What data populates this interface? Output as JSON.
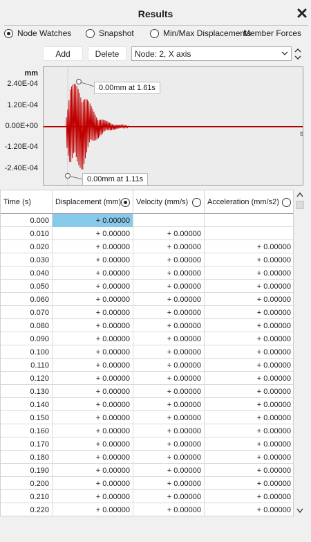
{
  "window": {
    "title": "Results"
  },
  "modes": [
    {
      "label": "Node Watches",
      "selected": true
    },
    {
      "label": "Snapshot",
      "selected": false
    },
    {
      "label": "Min/Max Displacements",
      "selected": false
    },
    {
      "label": "Member Forces",
      "selected": false
    }
  ],
  "toolbar": {
    "add_label": "Add",
    "delete_label": "Delete",
    "node_select": "Node: 2, X axis"
  },
  "chart": {
    "unit_label": "mm",
    "y_ticks": [
      "2.40E-04",
      "1.20E-04",
      "0.00E+00",
      "-1.20E-04",
      "-2.40E-04"
    ],
    "x_unit": "s",
    "max_callout": "0.00mm at 1.61s",
    "min_callout": "0.00mm at 1.11s"
  },
  "chart_data": {
    "type": "line",
    "series": [
      {
        "color": "#c00000"
      }
    ],
    "y_ticks": [
      0.00024,
      0.00012,
      0.0,
      -0.00012,
      -0.00024
    ],
    "ylim": [
      -0.0003,
      0.0003
    ],
    "peak_max": {
      "value_mm": 0.0,
      "time_s": 1.61
    },
    "peak_min": {
      "value_mm": 0.0,
      "time_s": 1.11
    },
    "ylabel": "mm",
    "xlabel": "s",
    "grid": false
  },
  "table": {
    "columns": [
      "Time (s)",
      "Displacement (mm)",
      "Velocity (mm/s)",
      "Acceleration (mm/s2)"
    ],
    "selected_column": 1,
    "rows": [
      [
        "0.000",
        "+ 0.00000",
        "",
        ""
      ],
      [
        "0.010",
        "+ 0.00000",
        "+ 0.00000",
        ""
      ],
      [
        "0.020",
        "+ 0.00000",
        "+ 0.00000",
        "+ 0.00000"
      ],
      [
        "0.030",
        "+ 0.00000",
        "+ 0.00000",
        "+ 0.00000"
      ],
      [
        "0.040",
        "+ 0.00000",
        "+ 0.00000",
        "+ 0.00000"
      ],
      [
        "0.050",
        "+ 0.00000",
        "+ 0.00000",
        "+ 0.00000"
      ],
      [
        "0.060",
        "+ 0.00000",
        "+ 0.00000",
        "+ 0.00000"
      ],
      [
        "0.070",
        "+ 0.00000",
        "+ 0.00000",
        "+ 0.00000"
      ],
      [
        "0.080",
        "+ 0.00000",
        "+ 0.00000",
        "+ 0.00000"
      ],
      [
        "0.090",
        "+ 0.00000",
        "+ 0.00000",
        "+ 0.00000"
      ],
      [
        "0.100",
        "+ 0.00000",
        "+ 0.00000",
        "+ 0.00000"
      ],
      [
        "0.110",
        "+ 0.00000",
        "+ 0.00000",
        "+ 0.00000"
      ],
      [
        "0.120",
        "+ 0.00000",
        "+ 0.00000",
        "+ 0.00000"
      ],
      [
        "0.130",
        "+ 0.00000",
        "+ 0.00000",
        "+ 0.00000"
      ],
      [
        "0.140",
        "+ 0.00000",
        "+ 0.00000",
        "+ 0.00000"
      ],
      [
        "0.150",
        "+ 0.00000",
        "+ 0.00000",
        "+ 0.00000"
      ],
      [
        "0.160",
        "+ 0.00000",
        "+ 0.00000",
        "+ 0.00000"
      ],
      [
        "0.170",
        "+ 0.00000",
        "+ 0.00000",
        "+ 0.00000"
      ],
      [
        "0.180",
        "+ 0.00000",
        "+ 0.00000",
        "+ 0.00000"
      ],
      [
        "0.190",
        "+ 0.00000",
        "+ 0.00000",
        "+ 0.00000"
      ],
      [
        "0.200",
        "+ 0.00000",
        "+ 0.00000",
        "+ 0.00000"
      ],
      [
        "0.210",
        "+ 0.00000",
        "+ 0.00000",
        "+ 0.00000"
      ],
      [
        "0.220",
        "+ 0.00000",
        "+ 0.00000",
        "+ 0.00000"
      ]
    ]
  },
  "icons": {
    "close": "close-icon",
    "dropdown": "chevron-down-icon",
    "spin_up": "chevron-up-icon",
    "spin_down": "chevron-down-icon"
  }
}
